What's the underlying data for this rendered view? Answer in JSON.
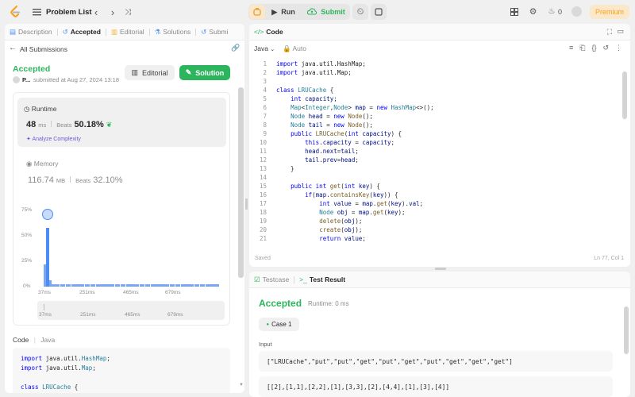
{
  "topbar": {
    "problem_list": "Problem List",
    "run": "Run",
    "submit": "Submit",
    "streak_count": "0",
    "premium": "Premium"
  },
  "left_tabs": [
    {
      "label": "Description",
      "icon": "document-icon"
    },
    {
      "label": "Accepted",
      "icon": "history-icon"
    },
    {
      "label": "Editorial",
      "icon": "book-icon"
    },
    {
      "label": "Solutions",
      "icon": "flask-icon"
    },
    {
      "label": "Submi",
      "icon": "clock-icon"
    }
  ],
  "submission": {
    "back_label": "All Submissions",
    "status": "Accepted",
    "user": "P...",
    "submitted_at": "submitted at Aug 27, 2024 13:18",
    "editorial_btn": "Editorial",
    "solution_btn": "Solution"
  },
  "runtime": {
    "title": "Runtime",
    "value": "48",
    "unit": "ms",
    "beats_label": "Beats",
    "beats_value": "50.18%",
    "analyze": "Analyze Complexity"
  },
  "memory": {
    "title": "Memory",
    "value": "116.74",
    "unit": "MB",
    "beats_label": "Beats",
    "beats_value": "32.10%"
  },
  "histogram": {
    "y_ticks": [
      "75%",
      "50%",
      "25%",
      "0%"
    ],
    "x_ticks": [
      "37ms",
      "251ms",
      "465ms",
      "679ms"
    ],
    "mini_ticks": [
      "37ms",
      "251ms",
      "465ms",
      "679ms"
    ],
    "bars_percent": [
      22,
      58,
      6,
      2,
      2,
      2,
      2,
      2,
      2,
      2,
      2,
      2,
      2,
      2,
      2,
      2,
      2,
      2,
      2,
      2,
      2,
      2,
      2,
      2,
      2,
      2,
      2,
      2,
      2,
      2,
      2,
      2,
      2,
      2,
      2,
      2,
      2,
      2,
      2,
      2,
      2,
      2,
      2,
      2,
      2,
      2,
      2,
      2,
      2,
      2,
      2,
      2,
      2,
      2,
      2,
      2,
      2,
      2,
      2,
      2,
      2,
      2,
      2,
      2
    ]
  },
  "bottom_code": {
    "label": "Code",
    "lang": "Java",
    "lines": [
      "import java.util.HashMap;",
      "import java.util.Map;",
      "",
      "class LRUCache {"
    ]
  },
  "editor": {
    "title": "Code",
    "language": "Java",
    "autosave": "Auto",
    "saved": "Saved",
    "cursor": "Ln 77, Col 1",
    "lines": [
      "import java.util.HashMap;",
      "import java.util.Map;",
      "",
      "class LRUCache {",
      "    int capacity;",
      "    Map<Integer,Node> map = new HashMap<>();",
      "    Node head = new Node();",
      "    Node tail = new Node();",
      "    public LRUCache(int capacity) {",
      "        this.capacity = capacity;",
      "        head.next=tail;",
      "        tail.prev=head;",
      "    }",
      "",
      "    public int get(int key) {",
      "        if(map.containsKey(key)) {",
      "            int value = map.get(key).val;",
      "            Node obj = map.get(key);",
      "            delete(obj);",
      "            create(obj);",
      "            return value;"
    ]
  },
  "testpanel": {
    "tab_testcase": "Testcase",
    "tab_result": "Test Result",
    "status": "Accepted",
    "runtime": "Runtime: 0 ms",
    "case": "Case 1",
    "input_label": "Input",
    "input_line1": "[\"LRUCache\",\"put\",\"put\",\"get\",\"put\",\"get\",\"put\",\"get\",\"get\",\"get\"]",
    "input_line2": "[[2],[1,1],[2,2],[1],[3,3],[2],[4,4],[1],[3],[4]]"
  },
  "colors": {
    "accent_green": "#2db55d",
    "run_orange": "#e3a23a",
    "premium": "#ffa116",
    "blue": "#4c8cf5"
  }
}
